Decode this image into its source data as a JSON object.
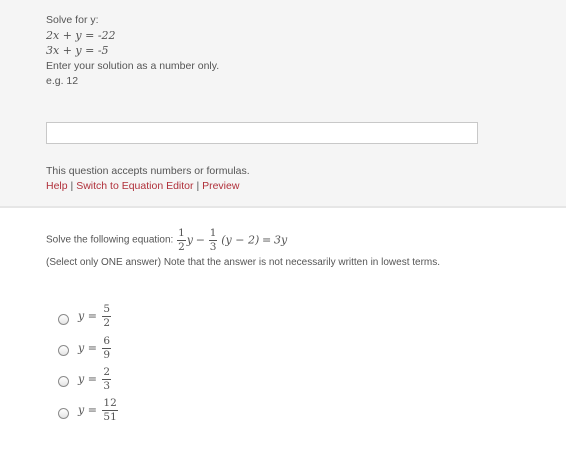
{
  "question1": {
    "prompt": "Solve for y:",
    "equations": [
      "2x + y = -22",
      "3x + y = -5"
    ],
    "instruction": "Enter your solution as a number only.",
    "example": "e.g. 12",
    "answer_value": "",
    "accepts_note": "This question accepts numbers or formulas.",
    "links": {
      "help": "Help",
      "switch": "Switch to Equation Editor",
      "preview": "Preview",
      "separator": "|"
    }
  },
  "question2": {
    "prompt": "Solve the following equation:",
    "equation": {
      "frac1": {
        "num": "1",
        "den": "2"
      },
      "frac2": {
        "num": "1",
        "den": "3"
      },
      "var1": "y",
      "minus": "−",
      "group": "(y − 2)",
      "equals": "=",
      "rhs": "3y"
    },
    "instruction": "(Select only ONE answer)  Note that the answer is not necessarily written in lowest terms.",
    "options": [
      {
        "lhs": "y =",
        "num": "5",
        "den": "2"
      },
      {
        "lhs": "y =",
        "num": "6",
        "den": "9"
      },
      {
        "lhs": "y =",
        "num": "2",
        "den": "3"
      },
      {
        "lhs": "y =",
        "num": "12",
        "den": "51"
      }
    ]
  }
}
